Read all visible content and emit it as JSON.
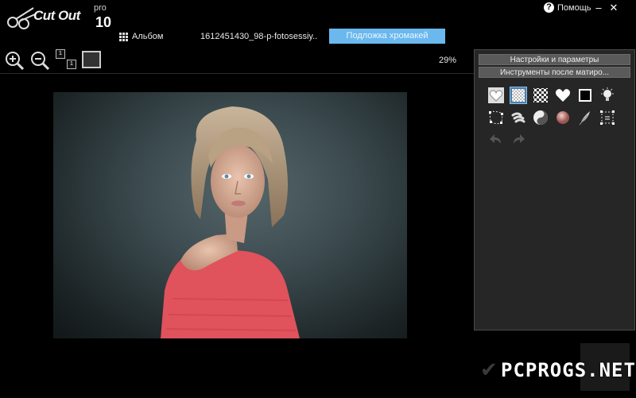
{
  "app": {
    "logo_name": "Cut Out",
    "logo_edition": "pro",
    "logo_version": "10"
  },
  "toolbar": {
    "album_label": "Альбом",
    "filename": "1612451430_98-p-fotosessiy..",
    "chroma_button": "Подложка хромакей",
    "zoom_percent": "29%",
    "actual_size_label": "1",
    "fit_label": "1"
  },
  "window": {
    "help_label": "Помощь",
    "minimize": "–",
    "close": "✕"
  },
  "panel": {
    "settings_header": "Настройки и параметры",
    "post_tools_header": "Инструменты после матиро..."
  },
  "watermark": "PCPROGS.NET",
  "colors": {
    "accent": "#6bb8ee",
    "selected_tool": "#4a7fae",
    "panel_bg": "#262626",
    "photo_shirt": "#e0525c"
  },
  "icons": {
    "row1": [
      "heart-icon",
      "transparency-icon",
      "checkerboard-icon",
      "heart-outline-icon",
      "square-icon",
      "bulb-icon"
    ],
    "row2": [
      "selection-points-icon",
      "brush-strokes-icon",
      "yin-yang-icon",
      "sphere-icon",
      "feather-icon",
      "selection-grid-icon"
    ],
    "row3": [
      "undo-icon",
      "redo-icon"
    ]
  }
}
